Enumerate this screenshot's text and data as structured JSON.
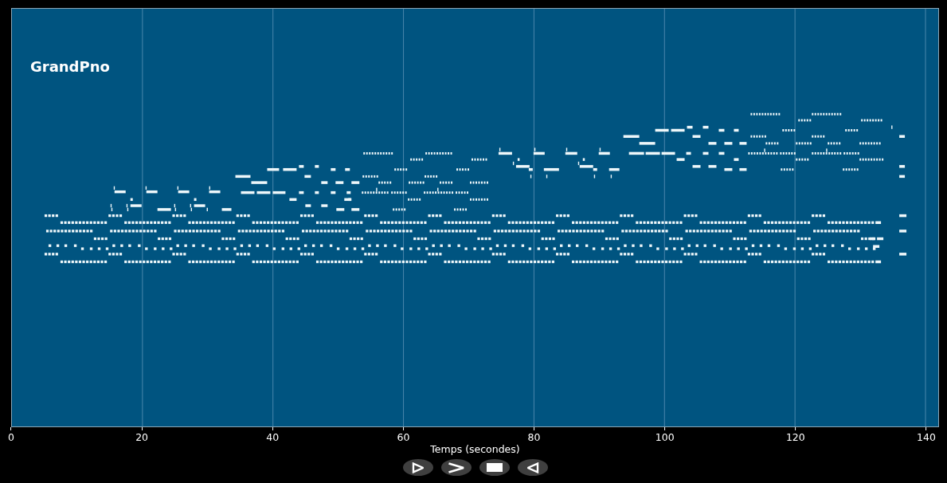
{
  "track": {
    "name": "GrandPno"
  },
  "x_axis": {
    "ticks": [
      "0",
      "20",
      "40",
      "60",
      "80",
      "100",
      "120",
      "140"
    ],
    "label": "Temps (secondes)"
  }
}
